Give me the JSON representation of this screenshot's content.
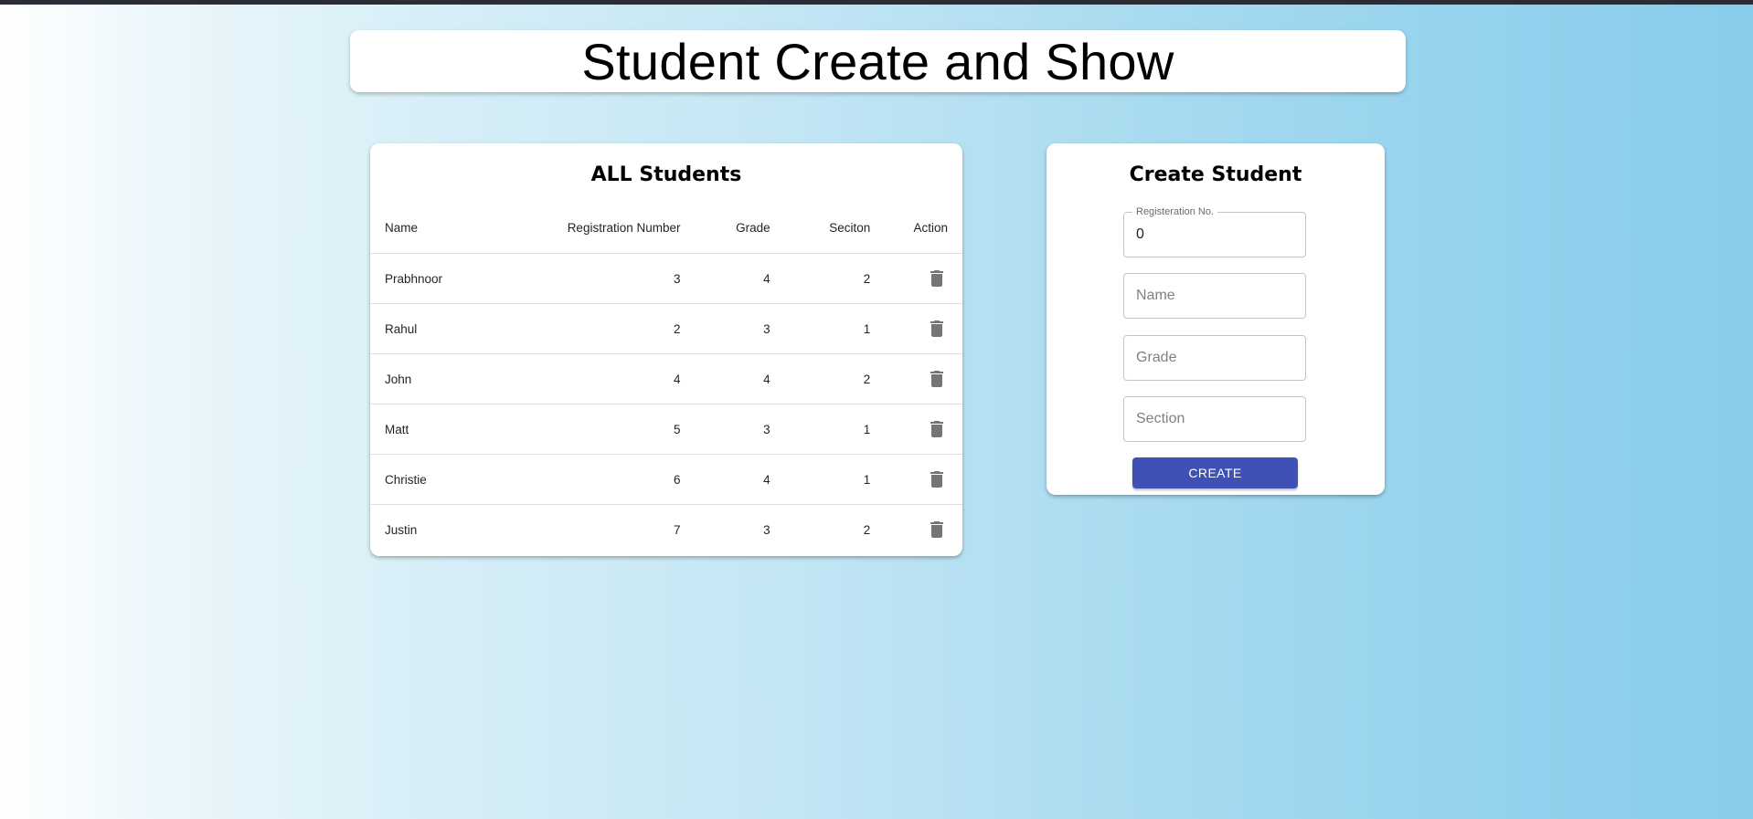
{
  "page": {
    "title": "Student Create and Show"
  },
  "students_panel": {
    "heading": "ALL Students",
    "columns": {
      "name": "Name",
      "registration": "Registration Number",
      "grade": "Grade",
      "section": "Seciton",
      "action": "Action"
    },
    "rows": [
      {
        "name": "Prabhnoor",
        "registration": "3",
        "grade": "4",
        "section": "2"
      },
      {
        "name": "Rahul",
        "registration": "2",
        "grade": "3",
        "section": "1"
      },
      {
        "name": "John",
        "registration": "4",
        "grade": "4",
        "section": "2"
      },
      {
        "name": "Matt",
        "registration": "5",
        "grade": "3",
        "section": "1"
      },
      {
        "name": "Christie",
        "registration": "6",
        "grade": "4",
        "section": "1"
      },
      {
        "name": "Justin",
        "registration": "7",
        "grade": "3",
        "section": "2"
      }
    ],
    "action_icon": "trash-icon"
  },
  "create_panel": {
    "heading": "Create Student",
    "registration_label": "Registeration No.",
    "registration_value": "0",
    "name_placeholder": "Name",
    "grade_placeholder": "Grade",
    "section_placeholder": "Section",
    "create_label": "CREATE"
  },
  "colors": {
    "accent": "#3f51b5",
    "topbar": "#2b2d36",
    "gradient_start": "#ffffff",
    "gradient_end": "#87cdea"
  }
}
